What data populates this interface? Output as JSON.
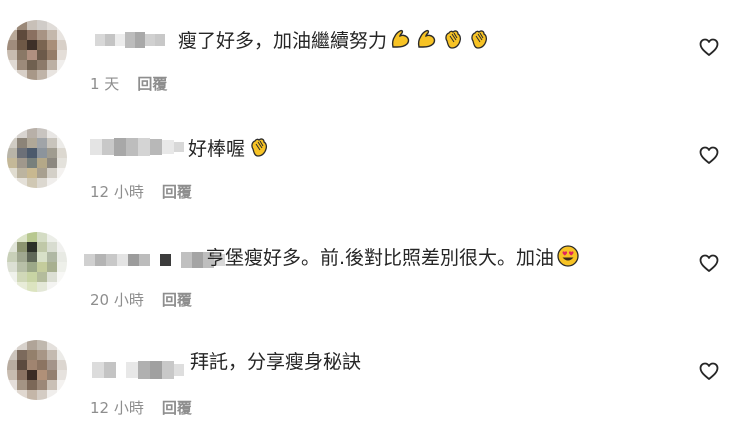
{
  "comments": [
    {
      "text": "瘦了好多，加油繼續努力",
      "emojis": [
        "flexed-biceps",
        "flexed-biceps",
        "clapping-hands",
        "clapping-hands"
      ],
      "time": "1 天",
      "reply_label": "回覆"
    },
    {
      "text": "好棒喔",
      "emojis": [
        "clapping-hands"
      ],
      "time": "12 小時",
      "reply_label": "回覆"
    },
    {
      "text": "亨堡瘦好多。前.後對比照差別很大。加油",
      "emojis": [
        "heart-eyes"
      ],
      "time": "20 小時",
      "reply_label": "回覆"
    },
    {
      "text": "拜託，分享瘦身秘訣",
      "emojis": [],
      "time": "12 小時",
      "reply_label": "回覆"
    }
  ],
  "colors": {
    "text": "#262626",
    "meta": "#8e8e8e",
    "emoji_yellow": "#f7c325",
    "emoji_outline": "#2b2b2b"
  }
}
